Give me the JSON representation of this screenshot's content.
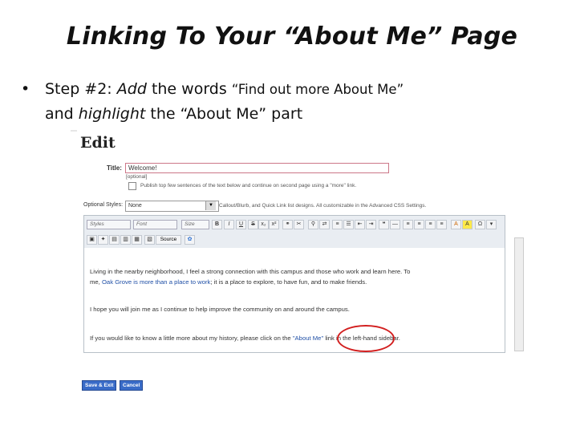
{
  "slide": {
    "title": "Linking To Your “About Me” Page",
    "bullet_step": "Step #2:",
    "bullet_verb1": "Add",
    "bullet_mid": "the words",
    "bullet_quote": "“Find out more About Me”",
    "bullet_and": "and",
    "bullet_verb2": "highlight",
    "bullet_end": "the “About Me” part"
  },
  "screenshot": {
    "heading": "Edit",
    "title_label": "Title:",
    "title_value": "Welcome!",
    "optional_note": "[optional]",
    "publish_note": "Publish top few sentences of the text below and continue on second page using a \"more\" link.",
    "optional_styles_label": "Optional Styles:",
    "optional_styles_value": "None",
    "styles_help": "Callout/Blurb, and Quick Link list designs. All customizable in the Advanced CSS Settings.",
    "toolbar": {
      "styles": "Styles",
      "font": "Font",
      "size": "Size",
      "source": "Source"
    },
    "paragraphs": {
      "p1_line1": "Living in the nearby neighborhood, I feel a strong connection with this campus and those who work and learn here.  To",
      "p1_line2_pre": "me, ",
      "p1_line2_link": "Oak Grove is more than a place to work",
      "p1_line2_post": "; it is a place to explore, to have fun, and to make friends.",
      "p2": "I hope you will join me as I continue to help improve the community on and around the campus.",
      "p3_pre": "If you would like to know a little more about my history, please click on the ",
      "p3_link": "\"About Me\"",
      "p3_post": " link in the left-hand sidebar."
    },
    "save_button": "Save & Exit",
    "cancel_button": "Cancel"
  }
}
